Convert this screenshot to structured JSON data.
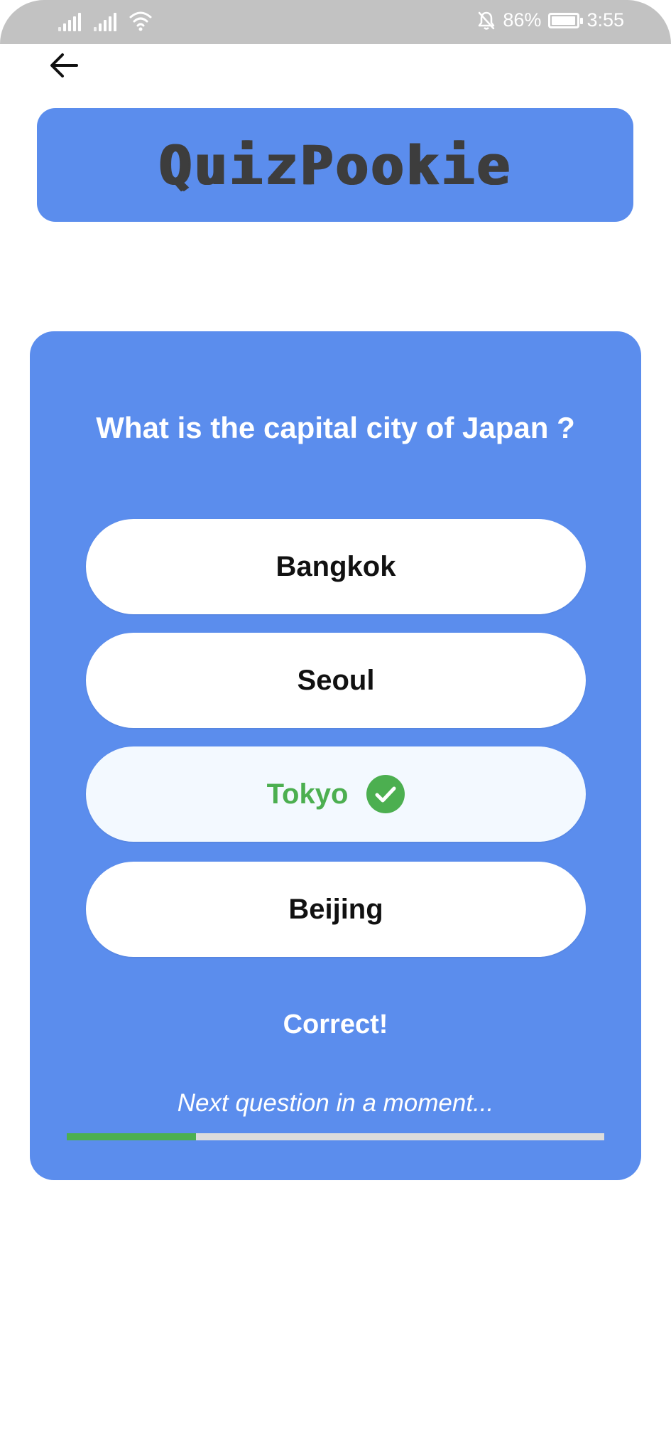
{
  "status_bar": {
    "battery_percent": "86%",
    "battery_level": 0.86,
    "time": "3:55",
    "icons": [
      "signal-icon",
      "signal-icon",
      "wifi-icon",
      "notifications-off-icon",
      "battery-icon"
    ]
  },
  "header": {
    "back_icon": "arrow-left-icon"
  },
  "logo": {
    "text": "QuizPookie"
  },
  "quiz": {
    "question": "What is the capital city of Japan ?",
    "options": [
      {
        "label": "Bangkok",
        "state": "default"
      },
      {
        "label": "Seoul",
        "state": "default"
      },
      {
        "label": "Tokyo",
        "state": "correct"
      },
      {
        "label": "Beijing",
        "state": "default"
      }
    ],
    "result": "Correct!",
    "next_message": "Next question in a moment...",
    "progress": 0.24
  },
  "colors": {
    "accent": "#5b8ded",
    "correct": "#4caf50",
    "status_bar": "#c2c2c2"
  }
}
